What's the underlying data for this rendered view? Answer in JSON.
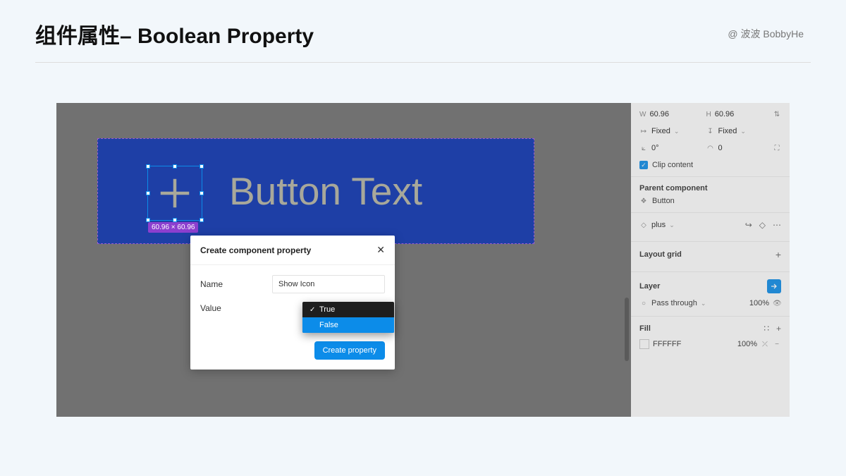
{
  "header": {
    "title": "组件属性– Boolean Property",
    "author": "@ 波波 BobbyHe"
  },
  "canvas": {
    "button_text": "Button Text",
    "selection_dim": "60.96 × 60.96"
  },
  "modal": {
    "title": "Create component property",
    "name_label": "Name",
    "name_value": "Show Icon",
    "value_label": "Value",
    "options": {
      "true": "True",
      "false": "False"
    },
    "create_btn": "Create property"
  },
  "props": {
    "w_label": "W",
    "w_value": "60.96",
    "h_label": "H",
    "h_value": "60.96",
    "wmode": "Fixed",
    "hmode": "Fixed",
    "rot_label": "0°",
    "rad_value": "0",
    "clip_label": "Clip content",
    "parent_title": "Parent component",
    "parent_name": "Button",
    "layer_name": "plus",
    "grid_title": "Layout grid",
    "layer_title": "Layer",
    "blend_mode": "Pass through",
    "opacity": "100%",
    "fill_title": "Fill",
    "fill_color": "FFFFFF",
    "fill_opacity": "100%"
  }
}
